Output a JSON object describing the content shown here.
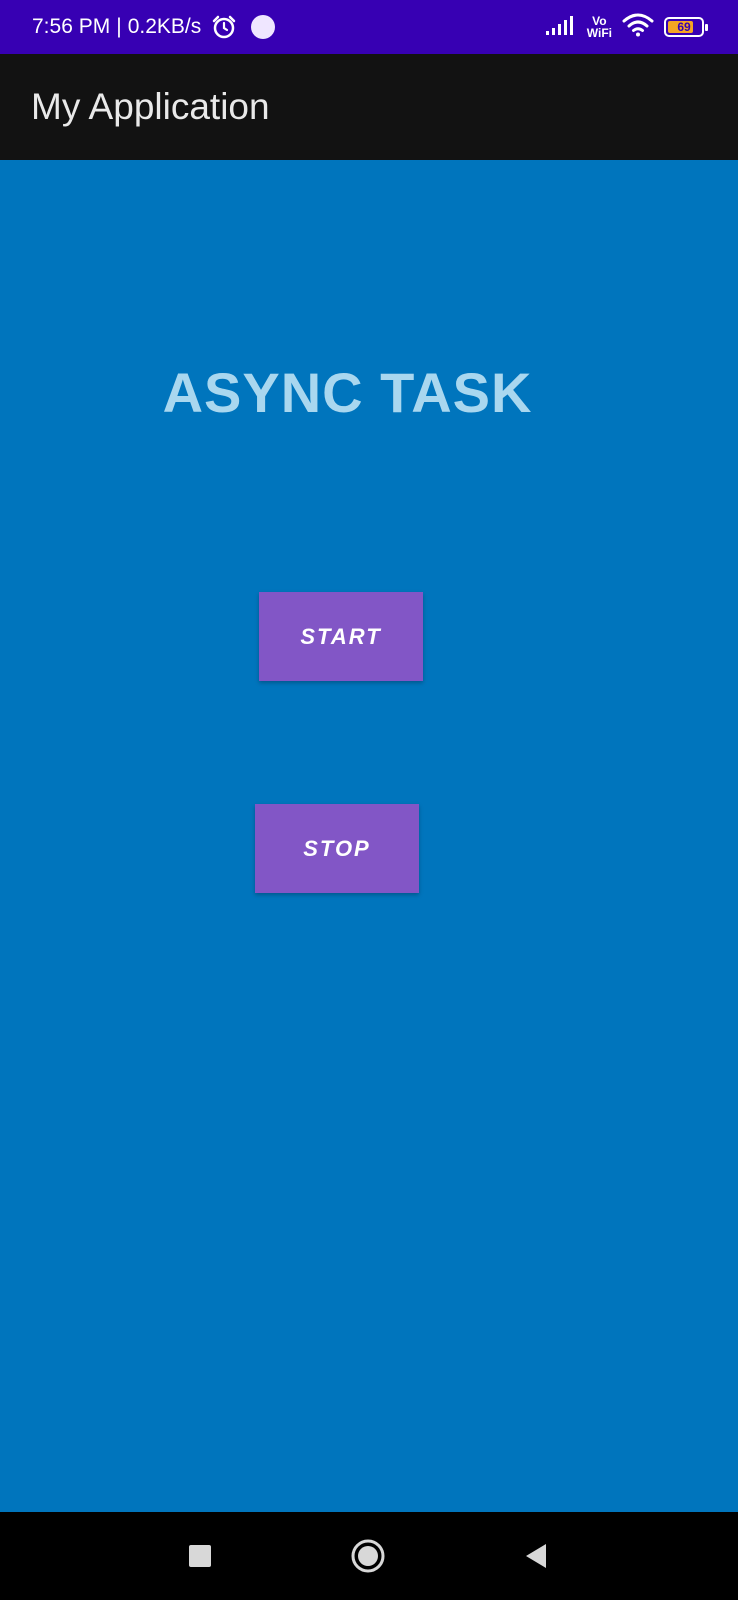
{
  "status_bar": {
    "time": "7:56 PM",
    "separator": "|",
    "net_speed": "0.2KB/s",
    "vowifi_top": "Vo",
    "vowifi_bottom": "WiFi",
    "battery_level": "69",
    "icons": [
      "alarm-icon",
      "notification-dot-icon",
      "signal-icon",
      "wifi-icon",
      "battery-icon"
    ],
    "bg_color": "#3700b3"
  },
  "app_bar": {
    "title": "My Application",
    "bg_color": "#121212"
  },
  "main": {
    "heading": "ASYNC TASK",
    "start_label": "START",
    "stop_label": "STOP",
    "bg_color": "#0075bd",
    "button_color": "#8256c6",
    "heading_color": "#a9d7ef"
  },
  "nav_bar": {
    "icons": [
      "recents-icon",
      "home-icon",
      "back-icon"
    ]
  }
}
